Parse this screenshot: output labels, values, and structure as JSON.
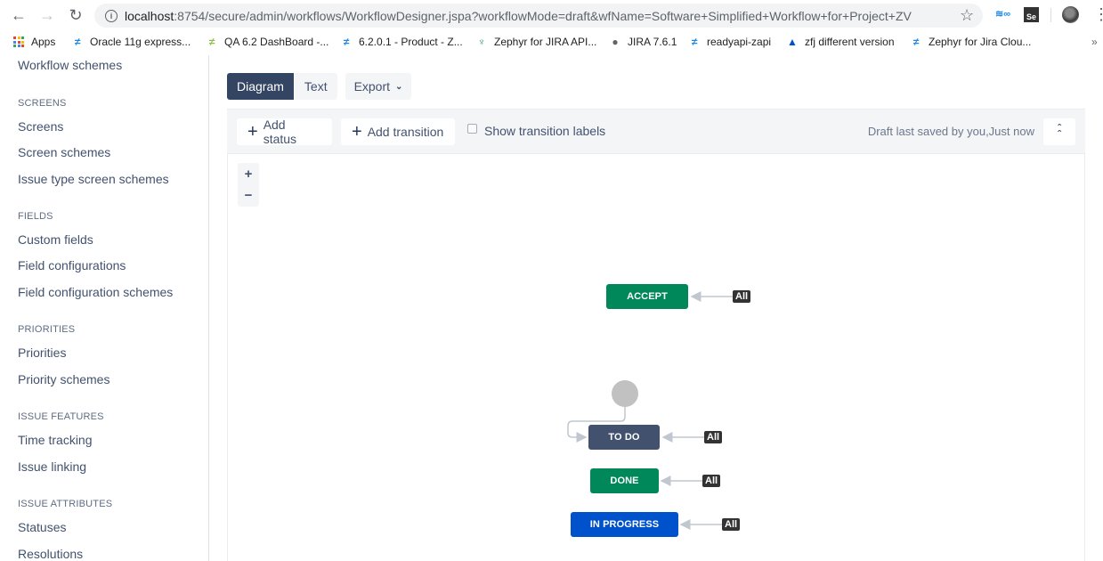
{
  "browser": {
    "url_host": "localhost",
    "url_rest": ":8754/secure/admin/workflows/WorkflowDesigner.jspa?workflowMode=draft&wfName=Software+Simplified+Workflow+for+Project+ZV",
    "ext2_label": "Se",
    "bookmarks": [
      {
        "label": "Apps",
        "icon": "apps-grid-icon"
      },
      {
        "label": "Oracle 11g express...",
        "icon": "zephyr-icon"
      },
      {
        "label": "QA 6.2 DashBoard -...",
        "icon": "zephyr-icon"
      },
      {
        "label": "6.2.0.1 - Product - Z...",
        "icon": "zephyr-icon"
      },
      {
        "label": "Zephyr for JIRA API...",
        "icon": "swagger-icon"
      },
      {
        "label": "JIRA 7.6.1",
        "icon": "globe-icon"
      },
      {
        "label": "readyapi-zapi",
        "icon": "zephyr-icon"
      },
      {
        "label": "zfj different version",
        "icon": "atlassian-icon"
      },
      {
        "label": "Zephyr for Jira Clou...",
        "icon": "zephyr-icon"
      }
    ],
    "more_bookmarks": "»"
  },
  "sidebar": {
    "items": [
      {
        "type": "link",
        "label": "Workflow schemes"
      },
      {
        "type": "heading",
        "label": "SCREENS"
      },
      {
        "type": "link",
        "label": "Screens"
      },
      {
        "type": "link",
        "label": "Screen schemes"
      },
      {
        "type": "link",
        "label": "Issue type screen schemes"
      },
      {
        "type": "heading",
        "label": "FIELDS"
      },
      {
        "type": "link",
        "label": "Custom fields"
      },
      {
        "type": "link",
        "label": "Field configurations"
      },
      {
        "type": "link",
        "label": "Field configuration schemes"
      },
      {
        "type": "heading",
        "label": "PRIORITIES"
      },
      {
        "type": "link",
        "label": "Priorities"
      },
      {
        "type": "link",
        "label": "Priority schemes"
      },
      {
        "type": "heading",
        "label": "ISSUE FEATURES"
      },
      {
        "type": "link",
        "label": "Time tracking"
      },
      {
        "type": "link",
        "label": "Issue linking"
      },
      {
        "type": "heading",
        "label": "ISSUE ATTRIBUTES"
      },
      {
        "type": "link",
        "label": "Statuses"
      },
      {
        "type": "link",
        "label": "Resolutions"
      }
    ]
  },
  "view_toggle": {
    "diagram": "Diagram",
    "text": "Text",
    "active": "Diagram"
  },
  "export": {
    "label": "Export"
  },
  "toolbar": {
    "add_status": "Add status",
    "add_transition": "Add transition",
    "show_labels": "Show transition labels",
    "show_labels_checked": false,
    "draft_status": "Draft last saved by you,Just now"
  },
  "zoom_controls": {
    "zoom_in": "+",
    "zoom_out": "−"
  },
  "workflow": {
    "colors": {
      "green": "#00875a",
      "navy": "#42526e",
      "blue": "#0052cc",
      "badge": "#333333",
      "connector": "#c1c7d0",
      "initial": "#c1c1c1"
    },
    "statuses": [
      {
        "name": "ACCEPT",
        "category": "done",
        "color": "#00875a",
        "global_transition": "All"
      },
      {
        "name": "TO DO",
        "category": "todo",
        "color": "#42526e",
        "global_transition": "All",
        "initial": true
      },
      {
        "name": "DONE",
        "category": "done",
        "color": "#00875a",
        "global_transition": "All"
      },
      {
        "name": "IN PROGRESS",
        "category": "in-progress",
        "color": "#0052cc",
        "global_transition": "All"
      }
    ]
  }
}
